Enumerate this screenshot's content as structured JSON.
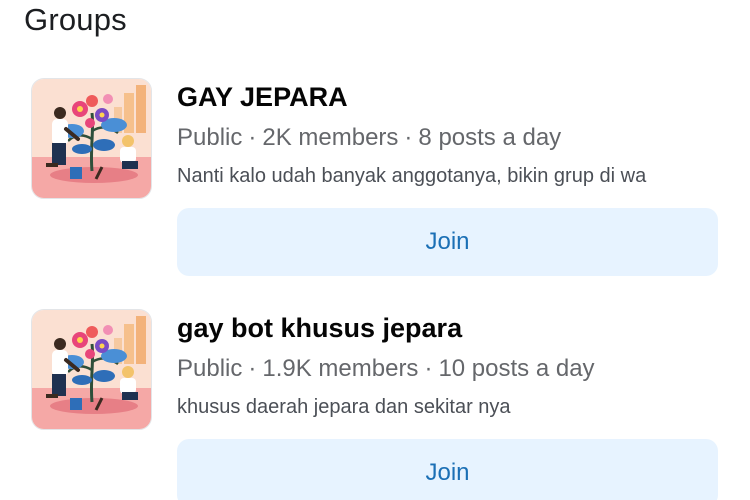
{
  "section": {
    "title": "Groups"
  },
  "groups": [
    {
      "name": "GAY JEPARA",
      "privacy": "Public",
      "members": "2K members",
      "activity": "8 posts a day",
      "description": "Nanti kalo udah banyak anggotanya, bikin grup di wa",
      "join_label": "Join",
      "thumbnail_icon": "gardening-illustration"
    },
    {
      "name": "gay bot khusus jepara",
      "privacy": "Public",
      "members": "1.9K members",
      "activity": "10 posts a day",
      "description": "khusus daerah jepara dan sekitar nya",
      "join_label": "Join",
      "thumbnail_icon": "gardening-illustration"
    }
  ],
  "colors": {
    "join_bg": "#e7f3ff",
    "join_text": "#1b6fb5",
    "meta_text": "#65676b",
    "thumbnail_bg": "#fbe0d2"
  }
}
